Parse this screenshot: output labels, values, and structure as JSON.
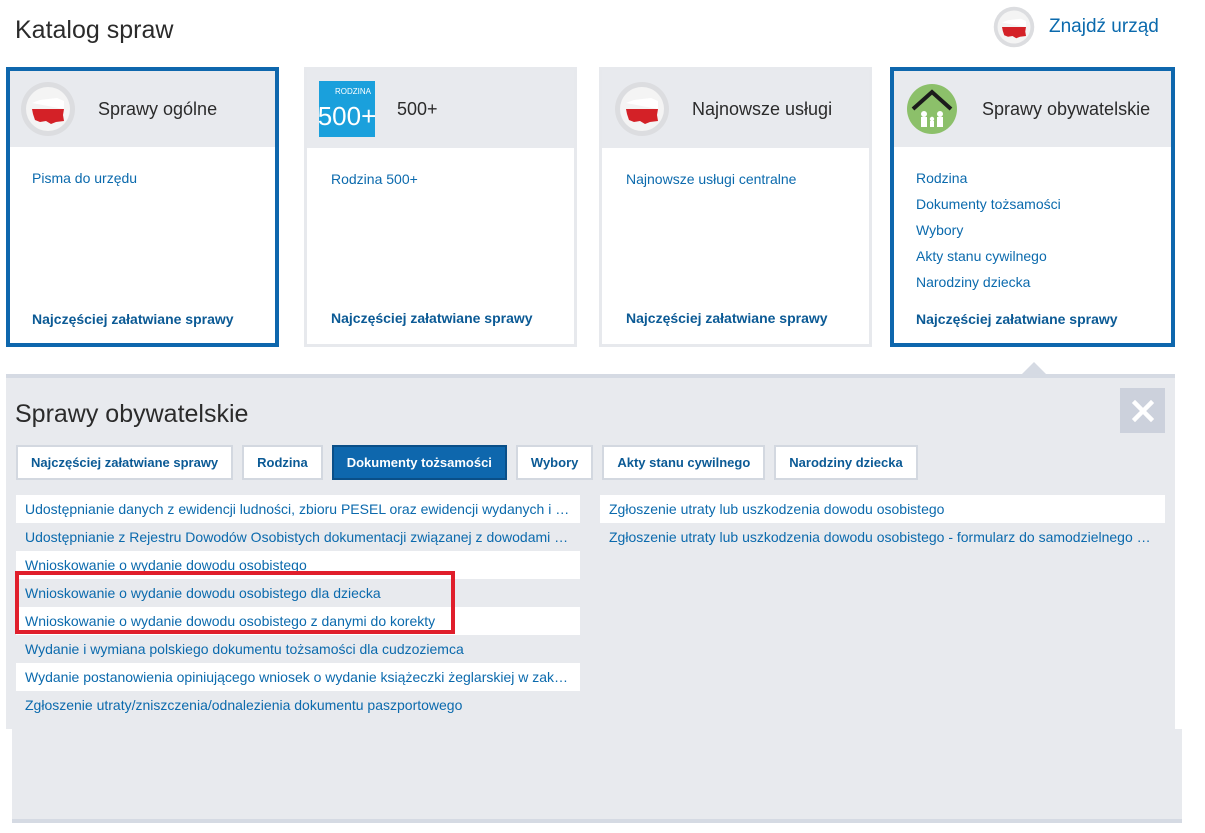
{
  "page_title": "Katalog spraw",
  "find_office": {
    "label": "Znajdź urząd",
    "icon": "poland-flag-icon"
  },
  "cards": [
    {
      "title": "Sprawy ogólne",
      "icon": "poland-flag-icon",
      "links": [
        "Pisma do urzędu"
      ],
      "footer": "Najczęściej załatwiane sprawy",
      "active": true
    },
    {
      "title": "500+",
      "icon": "rodzina-500-logo",
      "logo_small": "RODZINA",
      "logo_big": "500+",
      "links": [
        "Rodzina 500+"
      ],
      "footer": "Najczęściej załatwiane sprawy",
      "active": false
    },
    {
      "title": "Najnowsze usługi",
      "icon": "poland-flag-icon",
      "links": [
        "Najnowsze usługi centralne"
      ],
      "footer": "Najczęściej załatwiane sprawy",
      "active": false
    },
    {
      "title": "Sprawy obywatelskie",
      "icon": "family-house-icon",
      "links": [
        "Rodzina",
        "Dokumenty tożsamości",
        "Wybory",
        "Akty stanu cywilnego",
        "Narodziny dziecka"
      ],
      "footer": "Najczęściej załatwiane sprawy",
      "active": true
    }
  ],
  "panel": {
    "title": "Sprawy obywatelskie",
    "close_icon": "close-icon",
    "tabs": [
      {
        "label": "Najczęściej załatwiane sprawy",
        "active": false
      },
      {
        "label": "Rodzina",
        "active": false
      },
      {
        "label": "Dokumenty tożsamości",
        "active": true
      },
      {
        "label": "Wybory",
        "active": false
      },
      {
        "label": "Akty stanu cywilnego",
        "active": false
      },
      {
        "label": "Narodziny dziecka",
        "active": false
      }
    ],
    "services_left": [
      "Udostępnianie danych z ewidencji ludności, zbioru PESEL oraz ewidencji wydanych i unieważnionych dowodów osobistych",
      "Udostępnianie z Rejestru Dowodów Osobistych dokumentacji związanej z dowodami osobistymi",
      "Wnioskowanie o wydanie dowodu osobistego",
      "Wnioskowanie o wydanie dowodu osobistego dla dziecka",
      "Wnioskowanie o wydanie dowodu osobistego z danymi do korekty",
      "Wydanie i wymiana polskiego dokumentu tożsamości dla cudzoziemca",
      "Wydanie postanowienia opiniującego wniosek o wydanie książeczki żeglarskiej w zakresie",
      "Zgłoszenie utraty/zniszczenia/odnalezienia dokumentu paszportowego"
    ],
    "services_right": [
      "Zgłoszenie utraty lub uszkodzenia dowodu osobistego",
      "Zgłoszenie utraty lub uszkodzenia dowodu osobistego - formularz do samodzielnego wypełnienia"
    ]
  },
  "colors": {
    "accent": "#0e67ad",
    "link": "#0b6aad",
    "panel_bg": "#e8eaee",
    "highlight": "#e01e2b"
  }
}
